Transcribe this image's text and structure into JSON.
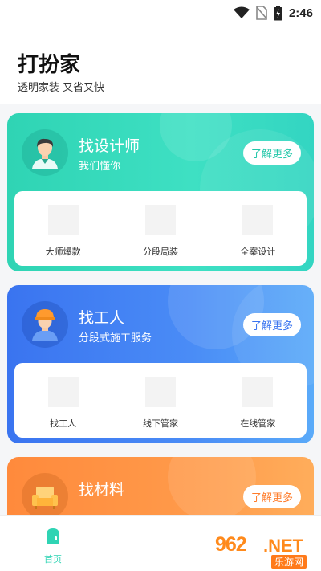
{
  "status_bar": {
    "time": "2:46"
  },
  "header": {
    "title": "打扮家",
    "subtitle": "透明家装 又省又快"
  },
  "cards": [
    {
      "title": "找设计师",
      "subtitle": "我们懂你",
      "more_label": "了解更多",
      "items": [
        {
          "label": "大师爆款"
        },
        {
          "label": "分段局装"
        },
        {
          "label": "全案设计"
        }
      ]
    },
    {
      "title": "找工人",
      "subtitle": "分段式施工服务",
      "more_label": "了解更多",
      "items": [
        {
          "label": "找工人"
        },
        {
          "label": "线下管家"
        },
        {
          "label": "在线管家"
        }
      ]
    },
    {
      "title": "找材料",
      "subtitle": "",
      "more_label": "了解更多"
    }
  ],
  "tabbar": {
    "home_label": "首页"
  },
  "watermark": {
    "brand": "962",
    "net": ".NET",
    "site": "乐游网"
  },
  "colors": {
    "teal": "#2fd4b4",
    "blue": "#3a74f0",
    "orange": "#ff8a3c"
  },
  "icons": [
    "wifi-icon",
    "no-sim-icon",
    "battery-charging-icon",
    "designer-avatar-icon",
    "worker-avatar-icon",
    "sofa-icon",
    "home-tab-icon"
  ]
}
